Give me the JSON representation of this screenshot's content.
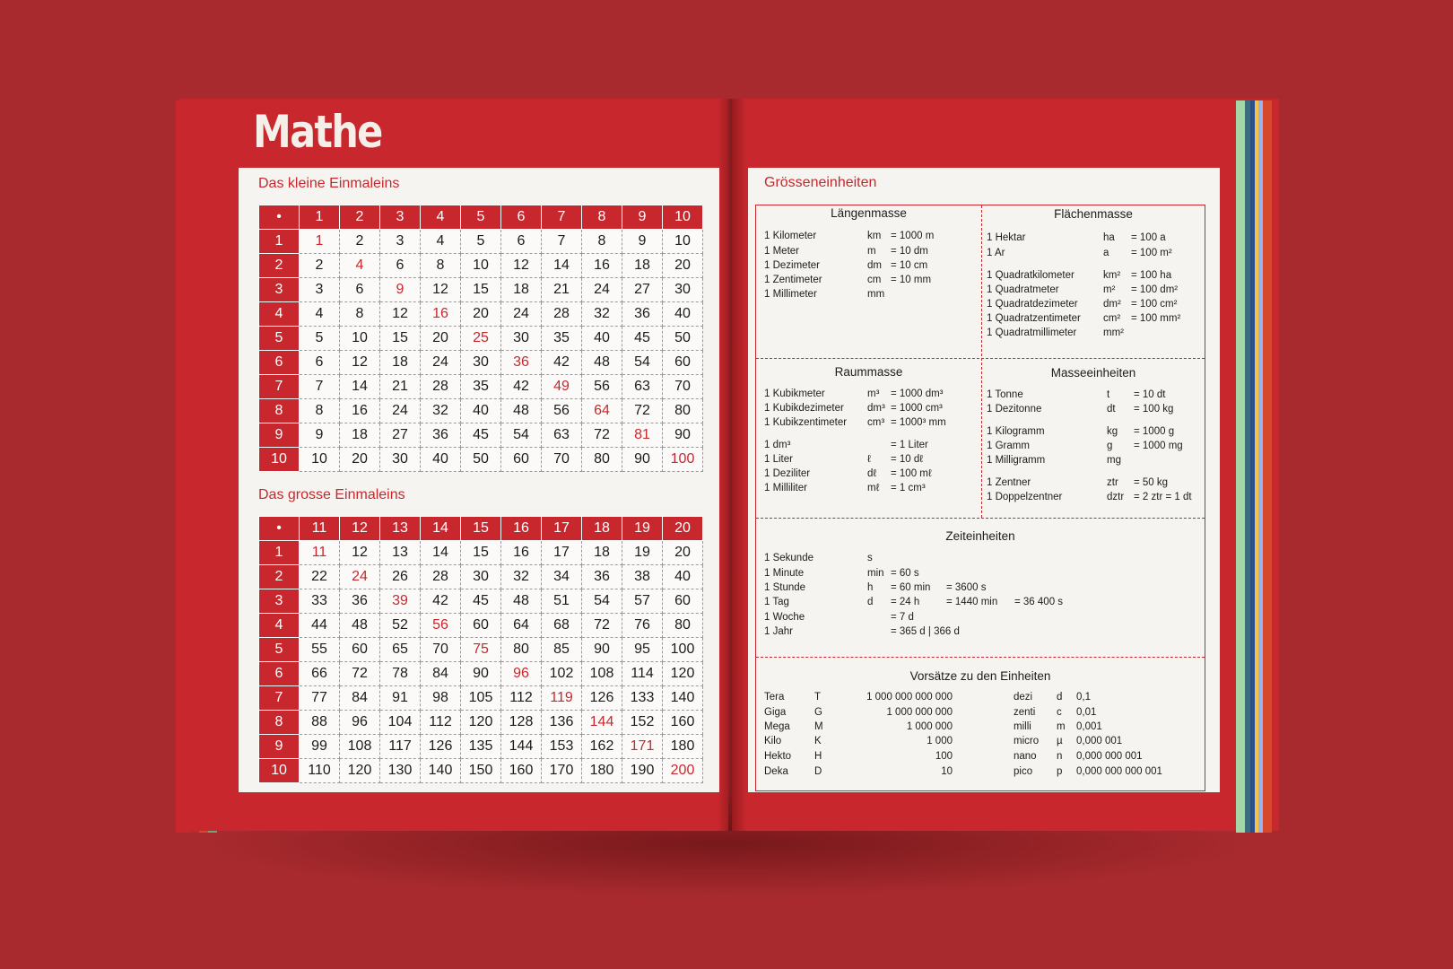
{
  "app": {
    "logo": "Mathe",
    "accent_color": "#c8282d",
    "background_color": "#a82a2e",
    "paper_color": "#f6f4f1",
    "edge_strip_colors_left": [
      "#c8282d",
      "#b72a2e",
      "#d6472c",
      "#6aa87c"
    ],
    "edge_strip_colors_right": [
      "#a5d6a6",
      "#3a6e7a",
      "#2e4f8a",
      "#f2c24a",
      "#9ab2e8",
      "#d6472c"
    ]
  },
  "small_table": {
    "title": "Das kleine Einmaleins",
    "corner_symbol": "•",
    "columns": [
      "1",
      "2",
      "3",
      "4",
      "5",
      "6",
      "7",
      "8",
      "9",
      "10"
    ],
    "rows": [
      {
        "label": "1",
        "values": [
          "1",
          "2",
          "3",
          "4",
          "5",
          "6",
          "7",
          "8",
          "9",
          "10"
        ]
      },
      {
        "label": "2",
        "values": [
          "2",
          "4",
          "6",
          "8",
          "10",
          "12",
          "14",
          "16",
          "18",
          "20"
        ]
      },
      {
        "label": "3",
        "values": [
          "3",
          "6",
          "9",
          "12",
          "15",
          "18",
          "21",
          "24",
          "27",
          "30"
        ]
      },
      {
        "label": "4",
        "values": [
          "4",
          "8",
          "12",
          "16",
          "20",
          "24",
          "28",
          "32",
          "36",
          "40"
        ]
      },
      {
        "label": "5",
        "values": [
          "5",
          "10",
          "15",
          "20",
          "25",
          "30",
          "35",
          "40",
          "45",
          "50"
        ]
      },
      {
        "label": "6",
        "values": [
          "6",
          "12",
          "18",
          "24",
          "30",
          "36",
          "42",
          "48",
          "54",
          "60"
        ]
      },
      {
        "label": "7",
        "values": [
          "7",
          "14",
          "21",
          "28",
          "35",
          "42",
          "49",
          "56",
          "63",
          "70"
        ]
      },
      {
        "label": "8",
        "values": [
          "8",
          "16",
          "24",
          "32",
          "40",
          "48",
          "56",
          "64",
          "72",
          "80"
        ]
      },
      {
        "label": "9",
        "values": [
          "9",
          "18",
          "27",
          "36",
          "45",
          "54",
          "63",
          "72",
          "81",
          "90"
        ]
      },
      {
        "label": "10",
        "values": [
          "10",
          "20",
          "30",
          "40",
          "50",
          "60",
          "70",
          "80",
          "90",
          "100"
        ]
      }
    ]
  },
  "large_table": {
    "title": "Das grosse Einmaleins",
    "corner_symbol": "•",
    "columns": [
      "11",
      "12",
      "13",
      "14",
      "15",
      "16",
      "17",
      "18",
      "19",
      "20"
    ],
    "rows": [
      {
        "label": "1",
        "values": [
          "11",
          "12",
          "13",
          "14",
          "15",
          "16",
          "17",
          "18",
          "19",
          "20"
        ]
      },
      {
        "label": "2",
        "values": [
          "22",
          "24",
          "26",
          "28",
          "30",
          "32",
          "34",
          "36",
          "38",
          "40"
        ]
      },
      {
        "label": "3",
        "values": [
          "33",
          "36",
          "39",
          "42",
          "45",
          "48",
          "51",
          "54",
          "57",
          "60"
        ]
      },
      {
        "label": "4",
        "values": [
          "44",
          "48",
          "52",
          "56",
          "60",
          "64",
          "68",
          "72",
          "76",
          "80"
        ]
      },
      {
        "label": "5",
        "values": [
          "55",
          "60",
          "65",
          "70",
          "75",
          "80",
          "85",
          "90",
          "95",
          "100"
        ]
      },
      {
        "label": "6",
        "values": [
          "66",
          "72",
          "78",
          "84",
          "90",
          "96",
          "102",
          "108",
          "114",
          "120"
        ]
      },
      {
        "label": "7",
        "values": [
          "77",
          "84",
          "91",
          "98",
          "105",
          "112",
          "119",
          "126",
          "133",
          "140"
        ]
      },
      {
        "label": "8",
        "values": [
          "88",
          "96",
          "104",
          "112",
          "120",
          "128",
          "136",
          "144",
          "152",
          "160"
        ]
      },
      {
        "label": "9",
        "values": [
          "99",
          "108",
          "117",
          "126",
          "135",
          "144",
          "153",
          "162",
          "171",
          "180"
        ]
      },
      {
        "label": "10",
        "values": [
          "110",
          "120",
          "130",
          "140",
          "150",
          "160",
          "170",
          "180",
          "190",
          "200"
        ]
      }
    ]
  },
  "units": {
    "title": "Grösseneinheiten",
    "laengenmasse": {
      "title": "Längenmasse",
      "rows": [
        {
          "name": "1 Kilometer",
          "sym": "km",
          "eq": "= 1000 m"
        },
        {
          "name": "1 Meter",
          "sym": "m",
          "eq": "= 10 dm"
        },
        {
          "name": "1 Dezimeter",
          "sym": "dm",
          "eq": "= 10 cm"
        },
        {
          "name": "1 Zentimeter",
          "sym": "cm",
          "eq": "= 10 mm"
        },
        {
          "name": "1 Millimeter",
          "sym": "mm",
          "eq": ""
        }
      ]
    },
    "flaechenmasse": {
      "title": "Flächenmasse",
      "rows": [
        {
          "name": "1 Hektar",
          "sym": "ha",
          "eq": "= 100 a"
        },
        {
          "name": "1 Ar",
          "sym": "a",
          "eq": "= 100 m²"
        },
        {
          "name": "1 Quadratkilometer",
          "sym": "km²",
          "eq": "= 100 ha"
        },
        {
          "name": "1 Quadratmeter",
          "sym": "m²",
          "eq": "= 100 dm²"
        },
        {
          "name": "1 Quadratdezimeter",
          "sym": "dm²",
          "eq": "= 100 cm²"
        },
        {
          "name": "1 Quadratzentimeter",
          "sym": "cm²",
          "eq": "= 100 mm²"
        },
        {
          "name": "1 Quadratmillimeter",
          "sym": "mm²",
          "eq": ""
        }
      ]
    },
    "raummasse": {
      "title": "Raummasse",
      "rows": [
        {
          "name": "1 Kubikmeter",
          "sym": "m³",
          "eq": "= 1000 dm³"
        },
        {
          "name": "1 Kubikdezimeter",
          "sym": "dm³",
          "eq": "= 1000 cm³"
        },
        {
          "name": "1 Kubikzentimeter",
          "sym": "cm³",
          "eq": "= 1000³ mm"
        },
        {
          "name": "1 dm³",
          "sym": "",
          "eq": "= 1 Liter"
        },
        {
          "name": "1 Liter",
          "sym": "ℓ",
          "eq": "= 10 dℓ"
        },
        {
          "name": "1 Deziliter",
          "sym": "dℓ",
          "eq": "= 100 mℓ"
        },
        {
          "name": "1 Milliliter",
          "sym": "mℓ",
          "eq": "= 1 cm³"
        }
      ]
    },
    "masseeinheiten": {
      "title": "Masseeinheiten",
      "rows": [
        {
          "name": "1 Tonne",
          "sym": "t",
          "eq": "= 10 dt"
        },
        {
          "name": "1 Dezitonne",
          "sym": "dt",
          "eq": "= 100 kg"
        },
        {
          "name": "1 Kilogramm",
          "sym": "kg",
          "eq": "= 1000 g"
        },
        {
          "name": "1 Gramm",
          "sym": "g",
          "eq": "= 1000 mg"
        },
        {
          "name": "1 Milligramm",
          "sym": "mg",
          "eq": ""
        },
        {
          "name": "1 Zentner",
          "sym": "ztr",
          "eq": "= 50 kg"
        },
        {
          "name": "1 Doppelzentner",
          "sym": "dztr",
          "eq": "= 2 ztr = 1 dt"
        }
      ]
    },
    "zeiteinheiten": {
      "title": "Zeiteinheiten",
      "rows": [
        {
          "name": "1 Sekunde",
          "sym": "s",
          "eq1": "",
          "eq2": "",
          "eq3": ""
        },
        {
          "name": "1 Minute",
          "sym": "min",
          "eq1": "= 60 s",
          "eq2": "",
          "eq3": ""
        },
        {
          "name": "1 Stunde",
          "sym": "h",
          "eq1": "= 60 min",
          "eq2": "= 3600 s",
          "eq3": ""
        },
        {
          "name": "1 Tag",
          "sym": "d",
          "eq1": "= 24 h",
          "eq2": "= 1440 min",
          "eq3": "= 36 400 s"
        },
        {
          "name": "1 Woche",
          "sym": "",
          "eq1": "= 7 d",
          "eq2": "",
          "eq3": ""
        },
        {
          "name": "1 Jahr",
          "sym": "",
          "eq1": "= 365 d | 366 d",
          "eq2": "",
          "eq3": ""
        }
      ]
    },
    "vorsaetze": {
      "title": "Vorsätze zu den Einheiten",
      "left": [
        {
          "name": "Tera",
          "sym": "T",
          "val": "1 000 000 000 000"
        },
        {
          "name": "Giga",
          "sym": "G",
          "val": "1 000 000 000"
        },
        {
          "name": "Mega",
          "sym": "M",
          "val": "1 000 000"
        },
        {
          "name": "Kilo",
          "sym": "K",
          "val": "1 000"
        },
        {
          "name": "Hekto",
          "sym": "H",
          "val": "100"
        },
        {
          "name": "Deka",
          "sym": "D",
          "val": "10"
        }
      ],
      "right": [
        {
          "name": "dezi",
          "sym": "d",
          "val": "0,1"
        },
        {
          "name": "zenti",
          "sym": "c",
          "val": "0,01"
        },
        {
          "name": "milli",
          "sym": "m",
          "val": "0,001"
        },
        {
          "name": "micro",
          "sym": "µ",
          "val": "0,000 001"
        },
        {
          "name": "nano",
          "sym": "n",
          "val": "0,000 000 001"
        },
        {
          "name": "pico",
          "sym": "p",
          "val": "0,000 000 000 001"
        }
      ]
    }
  }
}
